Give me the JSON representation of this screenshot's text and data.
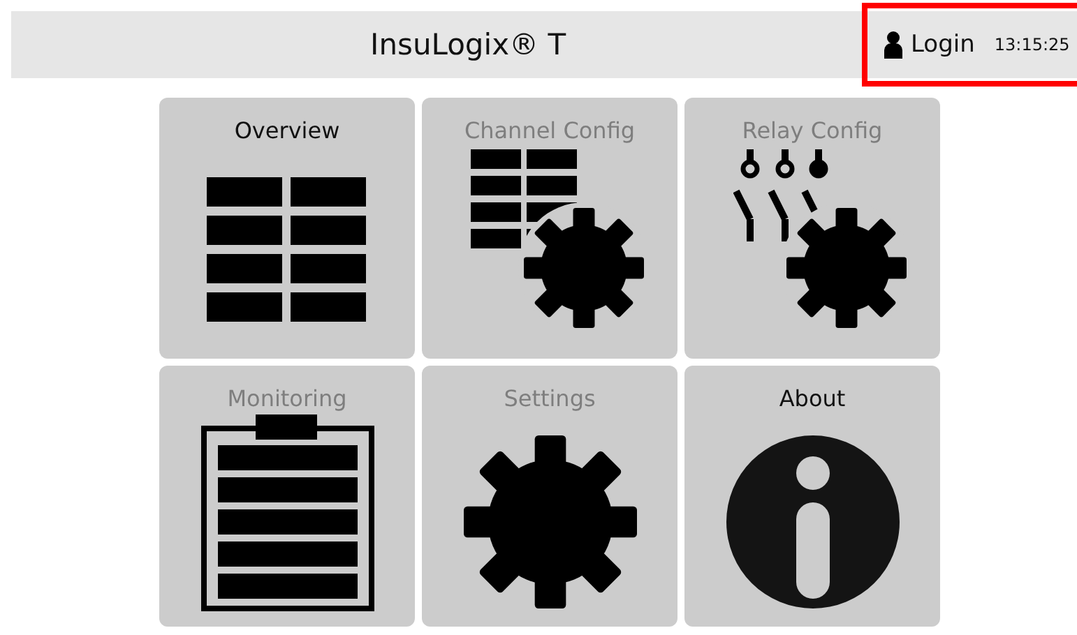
{
  "header": {
    "title": "InsuLogix® T",
    "login": "Login",
    "time": "13:15:25"
  },
  "tiles": [
    {
      "label": "Overview",
      "disabled": false
    },
    {
      "label": "Channel Config",
      "disabled": true
    },
    {
      "label": "Relay Config",
      "disabled": true
    },
    {
      "label": "Monitoring",
      "disabled": true
    },
    {
      "label": "Settings",
      "disabled": true
    },
    {
      "label": "About",
      "disabled": false
    }
  ]
}
